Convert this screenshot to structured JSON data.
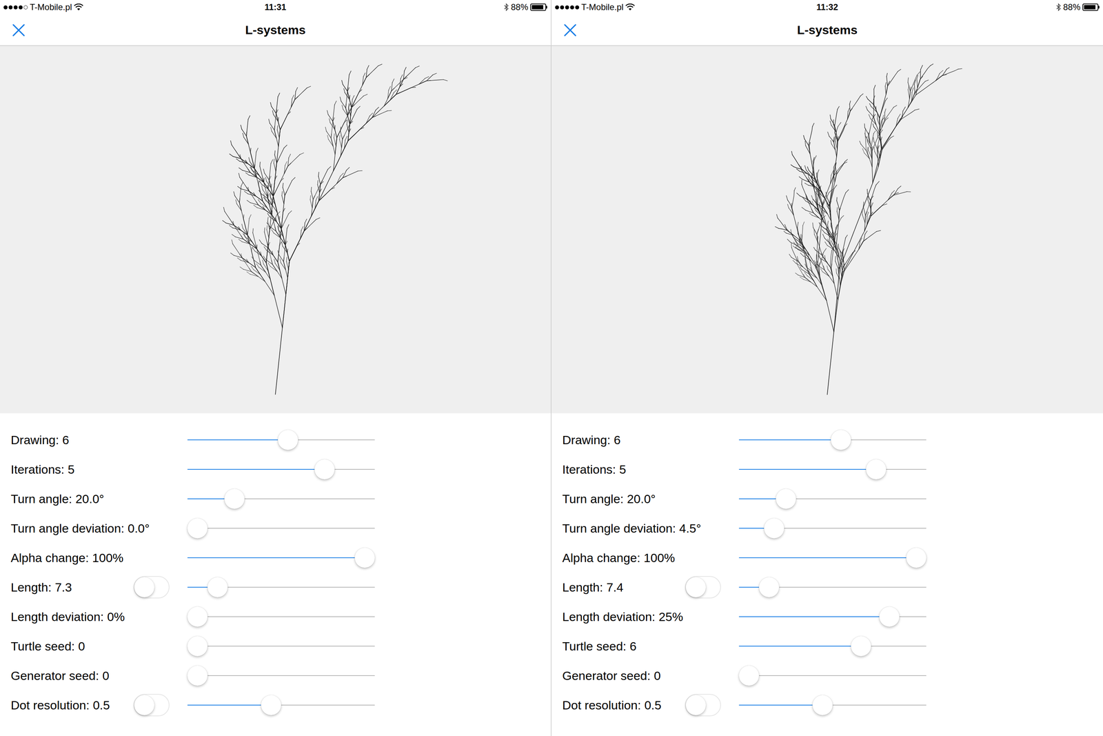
{
  "panels": [
    {
      "status_bar": {
        "signal": {
          "filled": 4,
          "total": 5
        },
        "carrier": "T-Mobile.pl",
        "time": "11:31",
        "battery": "88%",
        "battery_level": 0.88
      },
      "nav": {
        "title": "L-systems"
      },
      "controls": [
        {
          "label": "Drawing: 6",
          "kind": "slider",
          "level": 0.54
        },
        {
          "label": "Iterations: 5",
          "kind": "slider",
          "level": 0.76
        },
        {
          "label": "Turn angle: 20.0°",
          "kind": "slider",
          "level": 0.22
        },
        {
          "label": "Turn angle deviation: 0.0°",
          "kind": "slider",
          "level": 0
        },
        {
          "label": "Alpha change: 100%",
          "kind": "slider",
          "level": 1
        },
        {
          "label": "Length: 7.3",
          "kind": "toggle-slider",
          "on": false,
          "level": 0.12
        },
        {
          "label": "Length deviation: 0%",
          "kind": "slider",
          "level": 0
        },
        {
          "label": "Turtle seed: 0",
          "kind": "slider",
          "level": 0
        },
        {
          "label": "Generator seed: 0",
          "kind": "slider",
          "level": 0
        },
        {
          "label": "Dot resolution: 0.5",
          "kind": "toggle-slider",
          "on": false,
          "level": 0.44
        }
      ]
    },
    {
      "status_bar": {
        "signal": {
          "filled": 5,
          "total": 5
        },
        "carrier": "T-Mobile.pl",
        "time": "11:32",
        "battery": "88%",
        "battery_level": 0.88
      },
      "nav": {
        "title": "L-systems"
      },
      "controls": [
        {
          "label": "Drawing: 6",
          "kind": "slider",
          "level": 0.55
        },
        {
          "label": "Iterations: 5",
          "kind": "slider",
          "level": 0.76
        },
        {
          "label": "Turn angle: 20.0°",
          "kind": "slider",
          "level": 0.22
        },
        {
          "label": "Turn angle deviation: 4.5°",
          "kind": "slider",
          "level": 0.15
        },
        {
          "label": "Alpha change: 100%",
          "kind": "slider",
          "level": 1
        },
        {
          "label": "Length: 7.4",
          "kind": "toggle-slider",
          "on": false,
          "level": 0.12
        },
        {
          "label": "Length deviation: 25%",
          "kind": "slider",
          "level": 0.84
        },
        {
          "label": "Turtle seed: 6",
          "kind": "slider",
          "level": 0.67
        },
        {
          "label": "Generator seed: 0",
          "kind": "slider",
          "level": 0
        },
        {
          "label": "Dot resolution: 0.5",
          "kind": "toggle-slider",
          "on": false,
          "level": 0.44
        }
      ]
    }
  ]
}
